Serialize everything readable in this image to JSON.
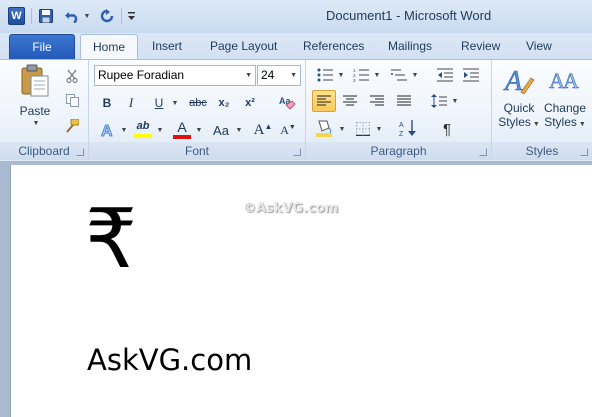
{
  "titlebar": {
    "app_icon": "W",
    "title": "Document1  -  Microsoft Word"
  },
  "tabs": {
    "file": "File",
    "items": [
      "Home",
      "Insert",
      "Page Layout",
      "References",
      "Mailings",
      "Review",
      "View"
    ]
  },
  "ribbon": {
    "clipboard": {
      "paste_label": "Paste",
      "group_label": "Clipboard"
    },
    "font": {
      "font_name": "Rupee Foradian",
      "font_size": "24",
      "group_label": "Font",
      "bold": "B",
      "italic": "I",
      "underline": "U",
      "strike": "abc",
      "subscript": "x₂",
      "superscript": "x²",
      "highlight": "ab",
      "font_color": "A",
      "change_case": "Aa",
      "grow": "A",
      "shrink": "A"
    },
    "paragraph": {
      "group_label": "Paragraph",
      "pilcrow": "¶"
    },
    "styles": {
      "quick_line1": "Quick",
      "quick_line2": "Styles",
      "change_line1": "Change",
      "change_line2": "Styles",
      "group_label": "Styles"
    }
  },
  "document": {
    "watermark": "©AskVG.com",
    "symbol": "₹",
    "text": "AskVG.com"
  },
  "colors": {
    "file_tab": "#2b63c0",
    "highlight_yellow": "#ffff00",
    "font_color_red": "#e01010",
    "active_align": "#f9c95a"
  }
}
